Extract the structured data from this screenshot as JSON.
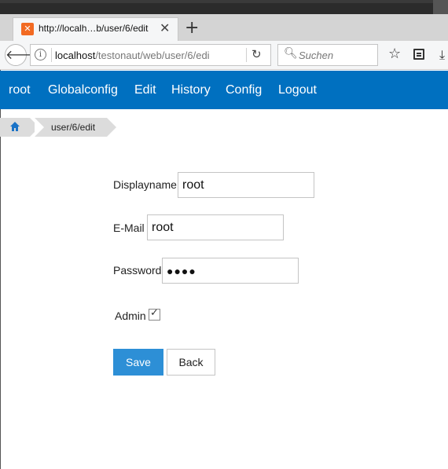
{
  "browser": {
    "tab_title": "http://localh…b/user/6/edit",
    "tab_close": "✕",
    "new_tab": "+",
    "url_host": "localhost",
    "url_path": "/testonaut/web/user/6/edi",
    "search_placeholder": "Suchen"
  },
  "app_menu": {
    "items": [
      {
        "label": "root"
      },
      {
        "label": "Globalconfig"
      },
      {
        "label": "Edit"
      },
      {
        "label": "History"
      },
      {
        "label": "Config"
      },
      {
        "label": "Logout"
      }
    ]
  },
  "breadcrumb": {
    "page": "user/6/edit"
  },
  "form": {
    "displayname_label": "Displayname",
    "displayname_value": "root",
    "email_label": "E-Mail",
    "email_value": "root",
    "password_label": "Password",
    "password_value": "●●●●",
    "admin_label": "Admin",
    "admin_checked": true,
    "save_label": "Save",
    "back_label": "Back"
  },
  "colors": {
    "menu_bar": "#0070c0",
    "save_button": "#2d8fd6"
  }
}
